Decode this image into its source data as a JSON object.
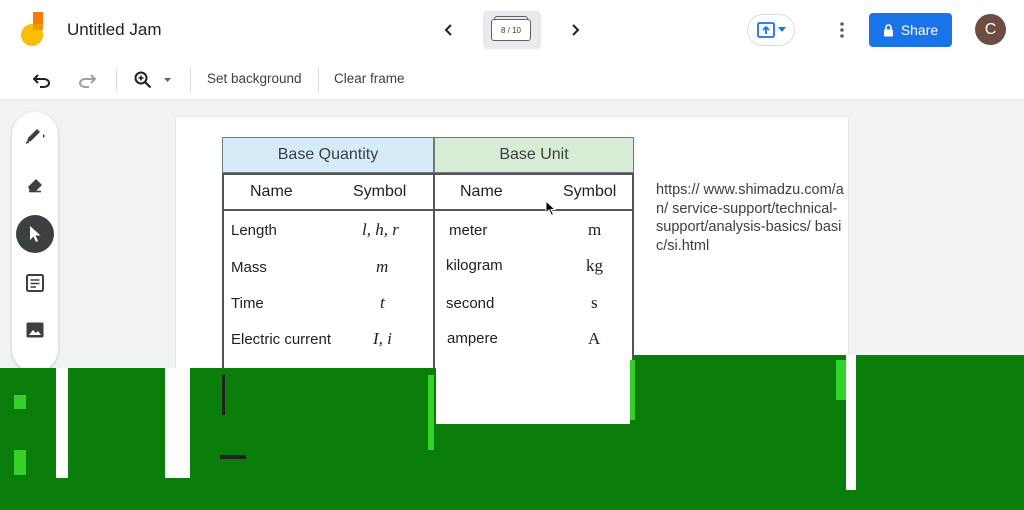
{
  "app": {
    "title": "Untitled Jam",
    "frame_indicator": "8 / 10",
    "share_label": "Share",
    "avatar_initial": "C"
  },
  "toolbar": {
    "set_background_label": "Set background",
    "clear_frame_label": "Clear frame"
  },
  "icons": {
    "undo": "undo-icon",
    "redo": "redo-icon",
    "zoom": "zoom-in-icon",
    "pen": "pen-icon",
    "eraser": "eraser-icon",
    "select": "pointer-icon",
    "sticky": "sticky-note-icon",
    "image": "image-icon"
  },
  "colors": {
    "share": "#1a73e8",
    "avatar": "#6d4c41",
    "quantity_header": "#d6ebf7",
    "unit_header": "#d7ebd5"
  },
  "table": {
    "quantity_header": "Base Quantity",
    "unit_header": "Base Unit",
    "sub_headers": [
      "Name",
      "Symbol",
      "Name",
      "Symbol"
    ],
    "rows": [
      {
        "quantity": "Length",
        "q_symbol": "l, h, r",
        "unit": "meter",
        "u_symbol": "m"
      },
      {
        "quantity": "Mass",
        "q_symbol": "m",
        "unit": "kilogram",
        "u_symbol": "kg"
      },
      {
        "quantity": "Time",
        "q_symbol": "t",
        "unit": "second",
        "u_symbol": "s"
      },
      {
        "quantity": "Electric current",
        "q_symbol": "I, i",
        "unit": "ampere",
        "u_symbol": "A"
      }
    ]
  },
  "note": {
    "url": "https:// www.shimadzu.com/an/ service-support/technical- support/analysis-basics/ basic/si.html"
  }
}
